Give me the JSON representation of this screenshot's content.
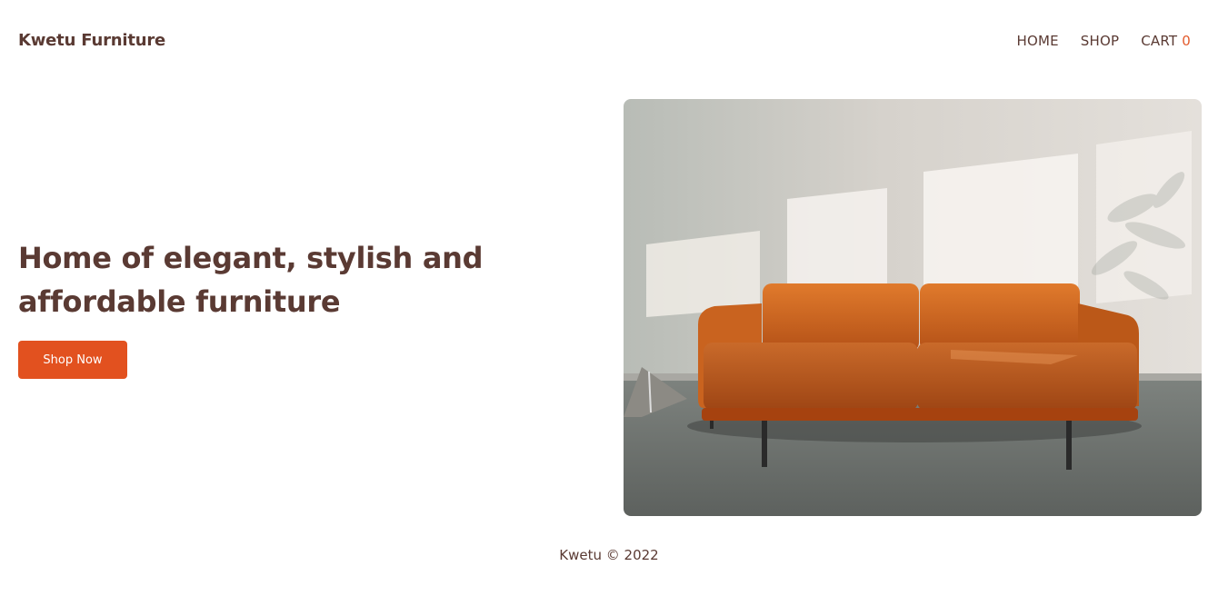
{
  "header": {
    "brand": "Kwetu Furniture",
    "nav": {
      "home": "HOME",
      "shop": "SHOP",
      "cart_label": "CART",
      "cart_count": "0"
    }
  },
  "hero": {
    "title": "Home of elegant, stylish and affordable furniture",
    "cta_label": "Shop Now",
    "image": "orange-leather-sofa-photo"
  },
  "footer": {
    "text": "Kwetu © 2022"
  },
  "colors": {
    "text": "#5a3a33",
    "accent": "#e2511f",
    "cart_count": "#e35b2c"
  }
}
